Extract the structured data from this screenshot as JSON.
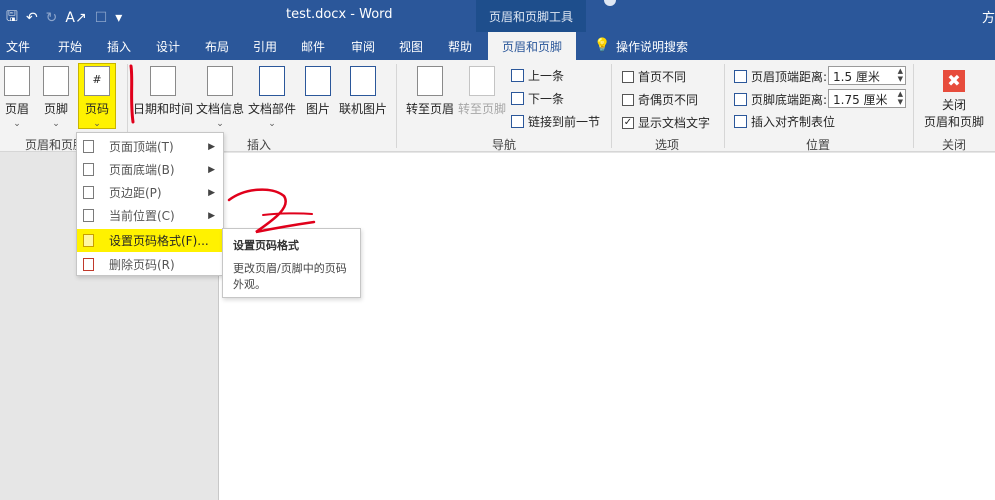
{
  "titlebar": {
    "doc_title": "test.docx  -  Word",
    "tool_title": "页眉和页脚工具",
    "user": "方"
  },
  "tabs": [
    "文件",
    "开始",
    "插入",
    "设计",
    "布局",
    "引用",
    "邮件",
    "审阅",
    "视图",
    "帮助",
    "页眉和页脚"
  ],
  "tell_me": "操作说明搜索",
  "ribbon": {
    "header_label": "页眉",
    "footer_label": "页脚",
    "pagecode_label": "页码",
    "group1": "页眉和页脚",
    "datetime_label": "日期和时间",
    "docinfo_label": "文档信息",
    "docparts_label": "文档部件",
    "picture_label": "图片",
    "online_picture_label": "联机图片",
    "group2": "插入",
    "goto_header_label": "转至页眉",
    "goto_footer_label": "转至页脚",
    "prev_label": "上一条",
    "next_label": "下一条",
    "link_prev_label": "链接到前一节",
    "group3": "导航",
    "diff_first_label": "首页不同",
    "diff_oddeven_label": "奇偶页不同",
    "show_text_label": "显示文档文字",
    "group4": "选项",
    "header_top_label": "页眉顶端距离:",
    "header_top_value": "1.5 厘米",
    "footer_bottom_label": "页脚底端距离:",
    "footer_bottom_value": "1.75 厘米",
    "insert_align_tab_label": "插入对齐制表位",
    "group5": "位置",
    "close_label_1": "关闭",
    "close_label_2": "页眉和页脚",
    "group6": "关闭"
  },
  "menu": {
    "items": [
      "页面顶端(T)",
      "页面底端(B)",
      "页边距(P)",
      "当前位置(C)",
      "设置页码格式(F)...",
      "删除页码(R)"
    ]
  },
  "tooltip": {
    "title": "设置页码格式",
    "body": "更改页眉/页脚中的页码外观。"
  },
  "colors": {
    "brand": "#2b579a",
    "highlight": "#fff200",
    "annotation": "#e0001b"
  }
}
